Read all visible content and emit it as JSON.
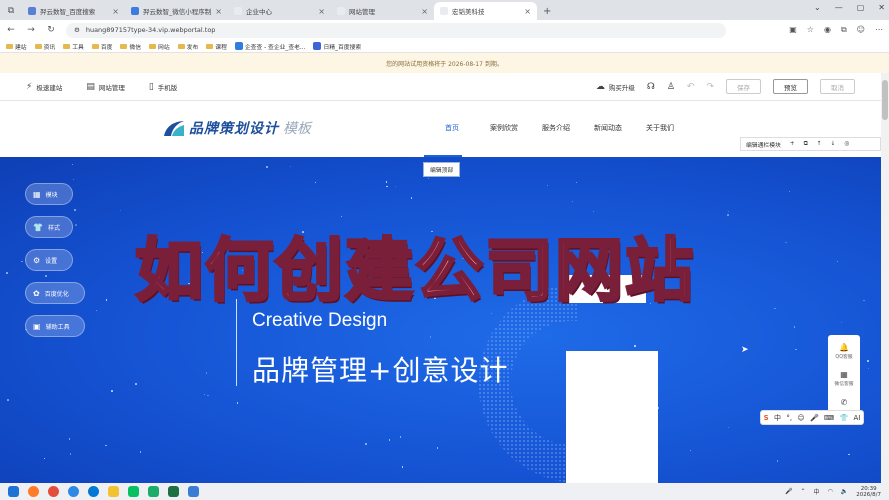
{
  "browser": {
    "tabs": [
      {
        "title": "羿云数智_百度搜索",
        "active": false
      },
      {
        "title": "羿云数智_微信小程序制作平台",
        "active": false
      },
      {
        "title": "企业中心",
        "active": false
      },
      {
        "title": "网站管理",
        "active": false
      },
      {
        "title": "宏韬美科技",
        "active": true
      }
    ],
    "url": "huang897157type-34.vip.webportal.top",
    "bookmarks": [
      "建站",
      "资讯",
      "工具",
      "百度",
      "微信",
      "网站",
      "发布",
      "课程",
      "企查查 - 查企业_查老...",
      "日精_百度搜索"
    ]
  },
  "notice": {
    "text": "您的网站试用资格将于 2026-08-17 到期。"
  },
  "editor": {
    "left": [
      {
        "label": "极速建站",
        "icon": "lightning-icon"
      },
      {
        "label": "网站管理",
        "icon": "site-manage-icon"
      },
      {
        "label": "手机版",
        "icon": "mobile-icon"
      }
    ],
    "upgrade": "购买升级",
    "save": "保存",
    "preview": "预览",
    "cancel": "取消"
  },
  "site": {
    "logo_main": "品牌策划设计",
    "logo_sub": "模板",
    "nav": [
      "首页",
      "案例欣赏",
      "服务介绍",
      "新闻动态",
      "关于我们"
    ],
    "active_nav": 0,
    "header_badge": "编辑顶部",
    "top_ctl_label": "编辑通栏模块"
  },
  "banner": {
    "overlay_title": "如何创建公司网站",
    "creative": "Creative Design",
    "slogan": "品牌管理+创意设计"
  },
  "left_panel": [
    {
      "label": "模块",
      "icon": "grid-icon"
    },
    {
      "label": "样式",
      "icon": "shirt-icon"
    },
    {
      "label": "设置",
      "icon": "gear-icon"
    },
    {
      "label": "百度优化",
      "icon": "seo-icon"
    },
    {
      "label": "辅助工具",
      "icon": "toolbox-icon"
    }
  ],
  "right_panel": [
    {
      "label": "QQ客服",
      "icon": "bell-icon"
    },
    {
      "label": "微信客服",
      "icon": "qr-icon"
    },
    {
      "label": "",
      "icon": "phone-icon"
    }
  ],
  "ime": [
    "S",
    "中",
    "°,",
    "☺",
    "🎤",
    "⌨",
    "👕",
    "AI"
  ],
  "taskbar": {
    "time": "20:39",
    "date": "2026/8/7",
    "lang": "中"
  },
  "colors": {
    "accent": "#1d63d3",
    "banner": "#1553d3",
    "title_pink": "#ff8fa0"
  }
}
